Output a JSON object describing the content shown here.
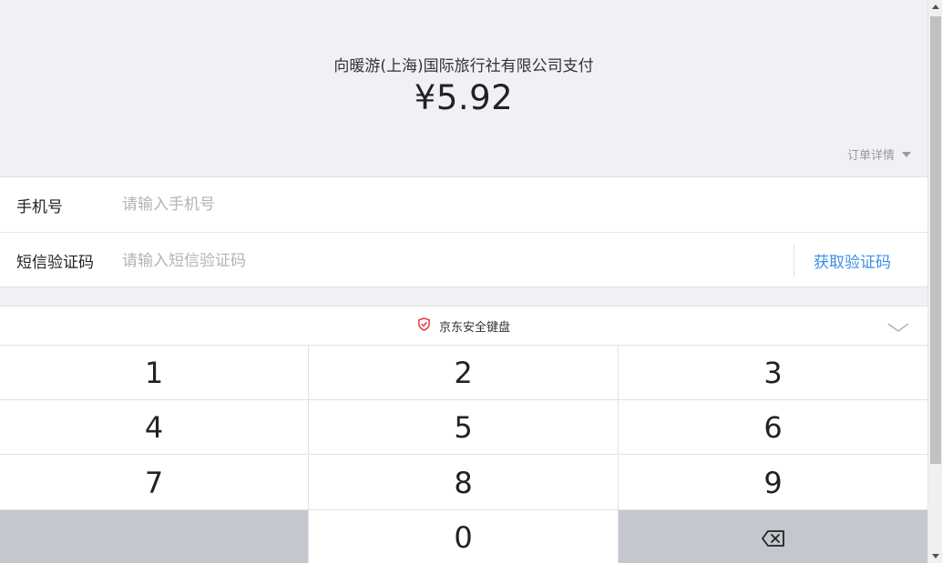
{
  "header": {
    "merchant_title": "向暖游(上海)国际旅行社有限公司支付",
    "amount": "¥5.92",
    "order_detail_label": "订单详情"
  },
  "form": {
    "phone": {
      "label": "手机号",
      "placeholder": "请输入手机号",
      "value": ""
    },
    "sms_code": {
      "label": "短信验证码",
      "placeholder": "请输入短信验证码",
      "value": "",
      "get_code_label": "获取验证码"
    }
  },
  "keyboard": {
    "title": "京东安全键盘",
    "keys": [
      "1",
      "2",
      "3",
      "4",
      "5",
      "6",
      "7",
      "8",
      "9",
      "",
      "0",
      "delete"
    ]
  },
  "colors": {
    "accent": "#3b8ee8",
    "shield": "#e4393c",
    "key_gray": "#c4c7ce",
    "background": "#f0f1f4"
  },
  "icons": {
    "order_detail": "caret-down-icon",
    "keyboard_badge": "shield-check-icon",
    "keyboard_collapse": "chevron-down-icon",
    "delete_key": "backspace-icon"
  }
}
